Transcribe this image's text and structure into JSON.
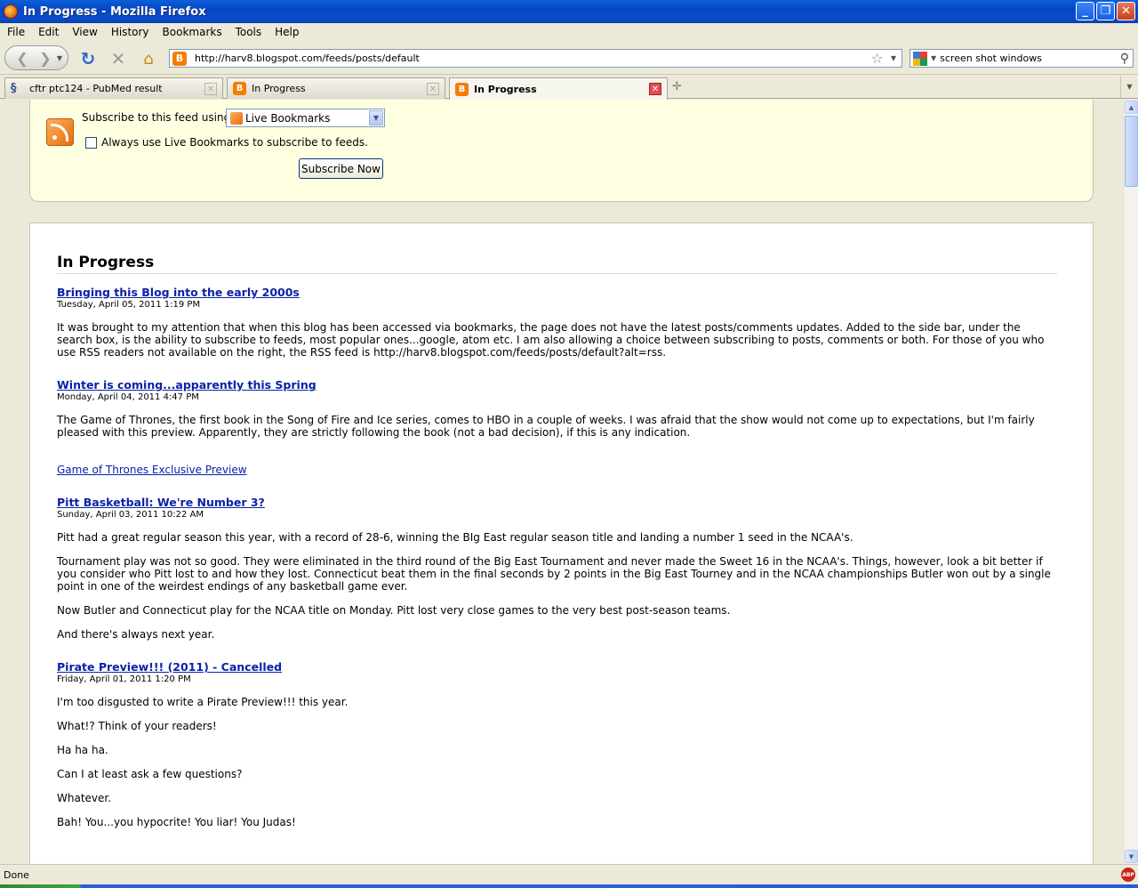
{
  "window": {
    "title": "In Progress - Mozilla Firefox"
  },
  "menu": [
    "File",
    "Edit",
    "View",
    "History",
    "Bookmarks",
    "Tools",
    "Help"
  ],
  "nav": {
    "url": "http://harv8.blogspot.com/feeds/posts/default",
    "search_query": "screen shot windows"
  },
  "tabs": [
    {
      "label": "cftr ptc124 - PubMed result",
      "active": false
    },
    {
      "label": "In Progress",
      "active": false
    },
    {
      "label": "In Progress",
      "active": true
    }
  ],
  "subscribe": {
    "label": "Subscribe to this feed using",
    "reader": "Live Bookmarks",
    "always_label": "Always use Live Bookmarks to subscribe to feeds.",
    "button": "Subscribe Now"
  },
  "feed": {
    "title": "In Progress",
    "entries": [
      {
        "title": "Bringing this Blog into the early 2000s",
        "date": "Tuesday, April 05, 2011 1:19 PM",
        "paragraphs": [
          "It was brought to my attention that when this blog has been accessed via bookmarks, the page does not have the latest posts/comments updates.  Added to the side bar, under the search box, is the ability to subscribe to feeds, most popular ones...google, atom etc.  I am also allowing a choice between subscribing to posts, comments or both.  For those of you who use RSS readers not available on the right, the RSS feed is http://harv8.blogspot.com/feeds/posts/default?alt=rss."
        ]
      },
      {
        "title": "Winter is coming...apparently this Spring",
        "date": "Monday, April 04, 2011 4:47 PM",
        "paragraphs": [
          "The Game of Thrones, the first book in the Song of Fire and Ice series, comes to HBO in a couple of weeks. I was afraid that the show would not come up to expectations, but I'm fairly pleased with this preview. Apparently, they are strictly following the book (not a bad decision), if this is any indication."
        ],
        "link": "Game of Thrones Exclusive Preview"
      },
      {
        "title": "Pitt Basketball: We're Number 3?",
        "date": "Sunday, April 03, 2011 10:22 AM",
        "paragraphs": [
          "Pitt had a great regular season this year, with a record of 28-6, winning the BIg East regular season title and landing a number 1 seed in the NCAA's.",
          "Tournament play was not so good. They were eliminated in the third round of the Big East Tournament and never made the Sweet 16 in the NCAA's. Things, however, look a bit better if you consider who Pitt lost to and how they lost. Connecticut beat them in the final seconds by 2 points in the Big East Tourney and in the NCAA championships Butler won out by a single point in one of the weirdest endings of any basketball game ever.",
          "Now Butler and Connecticut play for the NCAA title on Monday. Pitt lost very close games to the very best post-season teams.",
          "And there's always next year."
        ]
      },
      {
        "title": "Pirate Preview!!! (2011) - Cancelled",
        "date": "Friday, April 01, 2011 1:20 PM",
        "paragraphs": [
          "I'm too disgusted to write a Pirate Preview!!! this year.",
          "What!? Think of your readers!",
          "Ha ha ha.",
          "Can I at least ask a few questions?",
          "Whatever.",
          "Bah! You...you hypocrite! You liar! You Judas!"
        ]
      }
    ]
  },
  "status": {
    "text": "Done",
    "addon": "ABP"
  }
}
